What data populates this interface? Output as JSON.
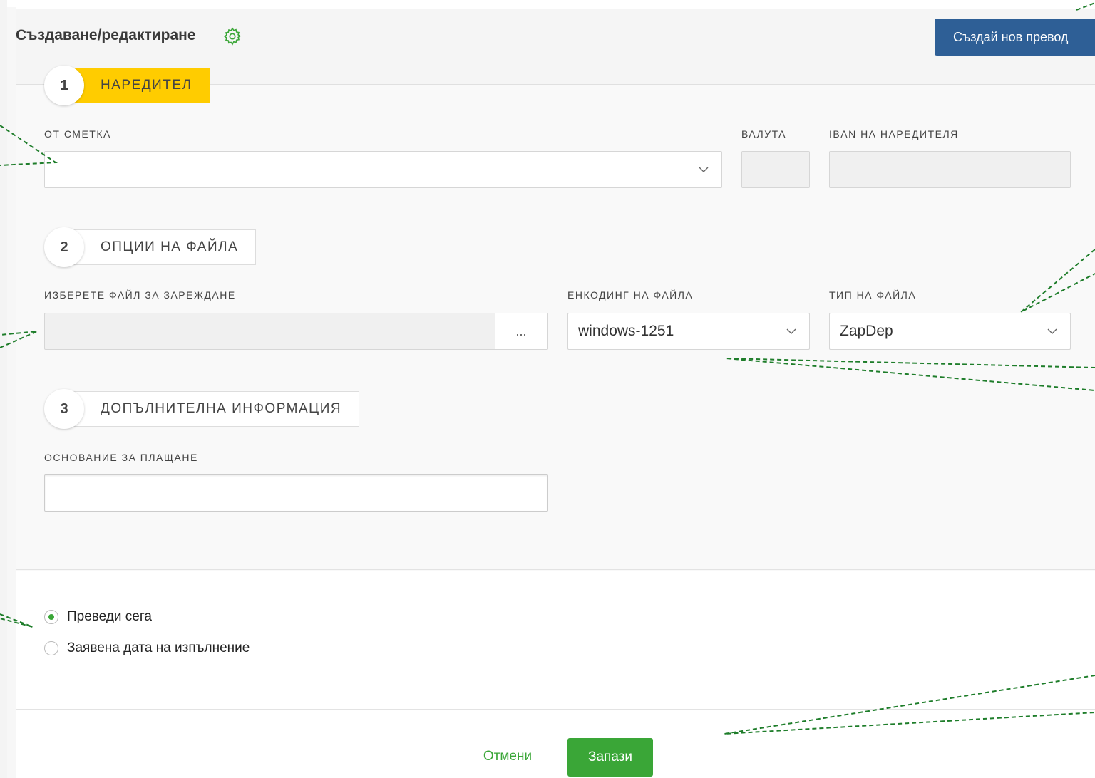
{
  "header": {
    "title": "Създаване/редактиране",
    "settings_icon": "gear-icon",
    "create_button": "Създай нов превод"
  },
  "steps": [
    {
      "number": "1",
      "label": "НАРЕДИТЕЛ"
    },
    {
      "number": "2",
      "label": "ОПЦИИ НА ФАЙЛА"
    },
    {
      "number": "3",
      "label": "ДОПЪЛНИТЕЛНА ИНФОРМАЦИЯ"
    }
  ],
  "section1": {
    "account_label": "ОТ СМЕТКА",
    "account_value": "",
    "currency_label": "ВАЛУТА",
    "currency_value": "",
    "iban_label": "IBAN НА НАРЕДИТЕЛЯ",
    "iban_value": ""
  },
  "section2": {
    "file_label": "ИЗБЕРЕТЕ ФАЙЛ ЗА ЗАРЕЖДАНЕ",
    "file_value": "",
    "browse_label": "...",
    "encoding_label": "ЕНКОДИНГ НА ФАЙЛА",
    "encoding_value": "windows-1251",
    "type_label": "ТИП НА ФАЙЛА",
    "type_value": "ZapDep"
  },
  "section3": {
    "reason_label": "ОСНОВАНИЕ ЗА ПЛАЩАНЕ",
    "reason_value": ""
  },
  "execution": {
    "options": [
      {
        "label": "Преведи сега",
        "checked": true
      },
      {
        "label": "Заявена дата на изпълнение",
        "checked": false
      }
    ]
  },
  "footer": {
    "cancel": "Отмени",
    "save": "Запази"
  },
  "colors": {
    "primary_blue": "#2e5f96",
    "accent_yellow": "#ffcc00",
    "green": "#3aa637",
    "annotation_lines": "#1e7d2a"
  }
}
